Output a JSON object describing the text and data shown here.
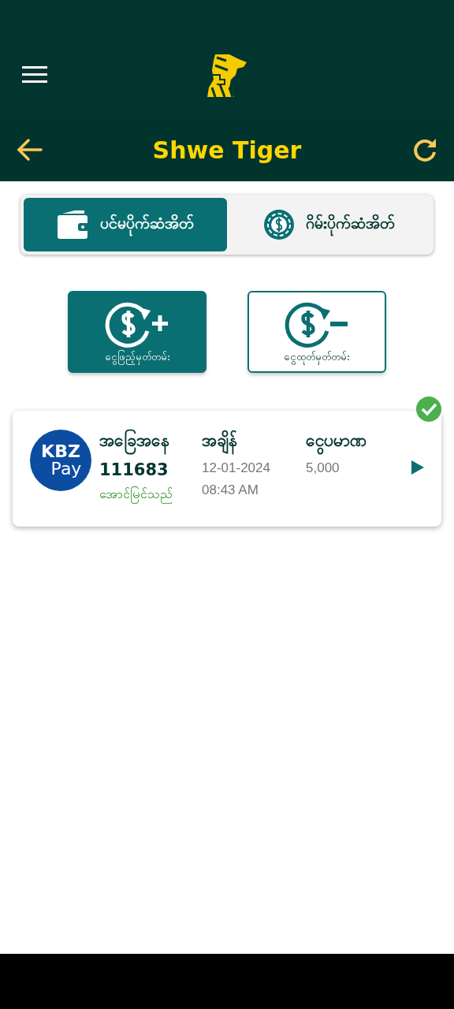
{
  "app_bar": {
    "title": "Shwe Tiger"
  },
  "tabs": [
    {
      "label": "ပင်မပိုက်ဆံအိတ်",
      "kind": "wallet",
      "selected": true
    },
    {
      "label": "ဂိမ်းပိုက်ဆံအိတ်",
      "kind": "chip",
      "selected": false
    }
  ],
  "actions": [
    {
      "label": "ငွေဖြည့်မှတ်တမ်း",
      "kind": "deposit",
      "selected": true
    },
    {
      "label": "ငွေထုတ်မှတ်တမ်း",
      "kind": "withdraw",
      "selected": false
    }
  ],
  "records": [
    {
      "logo": {
        "line_1": "KBZ",
        "line_2": "Pay"
      },
      "verified": true,
      "status_label": "အခြေအနေ",
      "id": "111683",
      "status": "အောင်မြင်သည်",
      "time_label": "အချိန်",
      "date": "12-01-2024",
      "time": "08:43 AM",
      "amount_label": "ငွေပမာဏ",
      "amount": "5,000"
    }
  ]
}
